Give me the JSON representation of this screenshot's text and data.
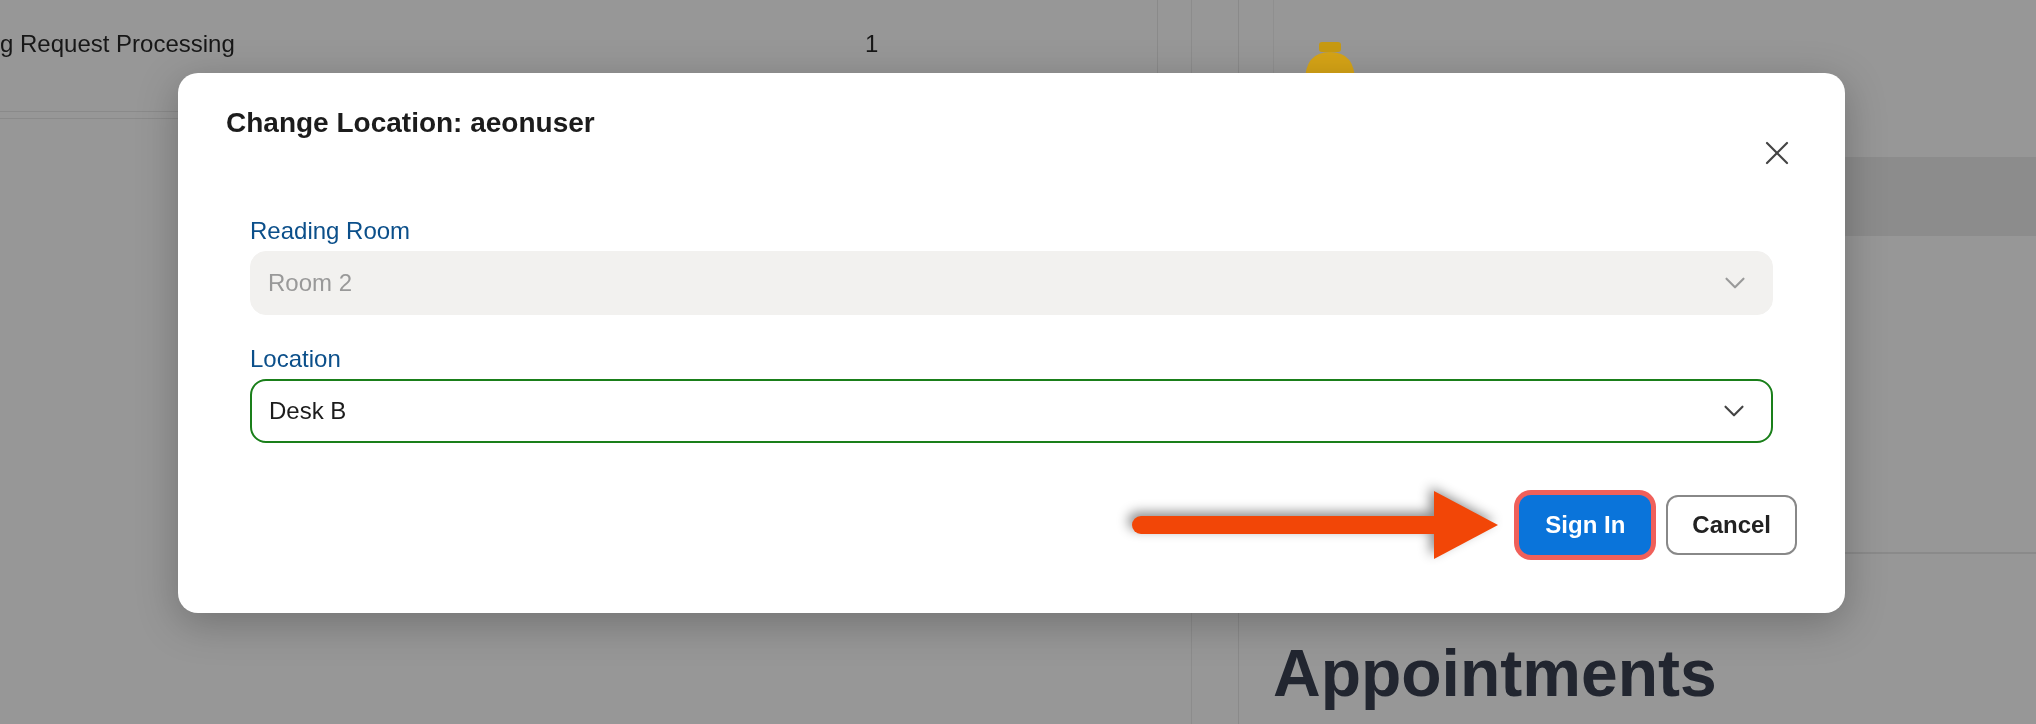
{
  "background": {
    "table_row": {
      "cells": [
        "g Request Processing",
        "1"
      ]
    },
    "heading": "Appointments"
  },
  "dialog": {
    "title": "Change Location: aeonuser",
    "fields": [
      {
        "label": "Reading Room",
        "value": "Room 2",
        "disabled": true
      },
      {
        "label": "Location",
        "value": "Desk B",
        "disabled": false
      }
    ],
    "buttons": [
      {
        "label": "Sign In",
        "kind": "primary",
        "highlighted": true
      },
      {
        "label": "Cancel",
        "kind": "secondary",
        "highlighted": false
      }
    ]
  }
}
